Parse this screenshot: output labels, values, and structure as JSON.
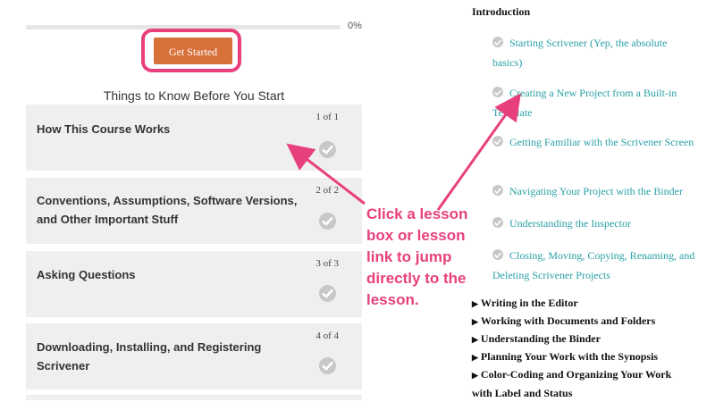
{
  "progress": {
    "percent_label": "0%",
    "value": 0
  },
  "start_button": {
    "label": "Get Started"
  },
  "section_title": "Things to Know Before You Start",
  "lessons": [
    {
      "title": "How This Course Works",
      "count": "1 of 1"
    },
    {
      "title": "Conventions, Assumptions, Software Versions, and Other Important Stuff",
      "count": "2 of 2"
    },
    {
      "title": "Asking Questions",
      "count": "3 of 3"
    },
    {
      "title": "Downloading, Installing, and Registering Scrivener",
      "count": "4 of 4"
    }
  ],
  "sidebar": {
    "heading": "Introduction",
    "lessons": [
      "Starting Scrivener (Yep, the absolute basics)",
      "Creating a New Project from a Built-in Template",
      "Getting Familiar with the Scrivener Screen",
      "Navigating Your Project with the Binder",
      "Understanding the Inspector",
      "Closing, Moving, Copying, Renaming, and Deleting Scrivener Projects"
    ],
    "sections": [
      "Writing in the Editor",
      "Working with Documents and Folders",
      "Understanding the Binder",
      "Planning Your Work with the Synopsis",
      "Color-Coding and Organizing Your Work with Label and Status"
    ]
  },
  "annotation": {
    "text": "Click a lesson box or lesson link to jump directly to the lesson."
  },
  "colors": {
    "accent": "#e8407d",
    "button": "#d8703a",
    "link": "#2aa0a6",
    "card": "#efefef"
  },
  "icons": {
    "complete": "check-circle-icon",
    "expand": "triangle-right-icon"
  }
}
